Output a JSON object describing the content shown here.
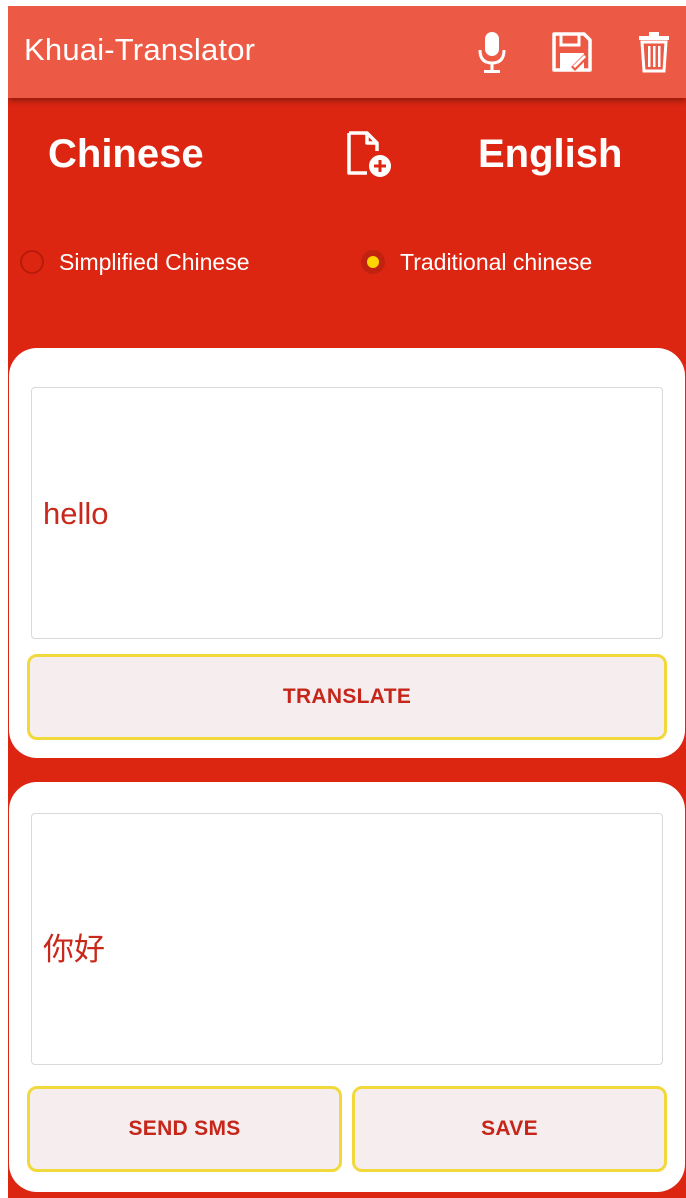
{
  "app": {
    "title": "Khuai-Translator"
  },
  "toolbar": {
    "icons": [
      "microphone-icon",
      "save-icon",
      "trash-icon"
    ]
  },
  "languages": {
    "from": "Chinese",
    "to": "English",
    "swap_icon": "document-add-icon"
  },
  "script_options": [
    {
      "label": "Simplified Chinese",
      "checked": false
    },
    {
      "label": "Traditional chinese",
      "checked": true
    }
  ],
  "input": {
    "text": "hello",
    "translate_label": "TRANSLATE"
  },
  "output": {
    "text": "你好",
    "send_sms_label": "SEND SMS",
    "save_label": "SAVE"
  },
  "colors": {
    "background": "#dd2612",
    "appbar": "#ec5a45",
    "text_accent": "#c8291b",
    "button_border": "#f2d93b",
    "radio_checked": "#ffd400"
  }
}
